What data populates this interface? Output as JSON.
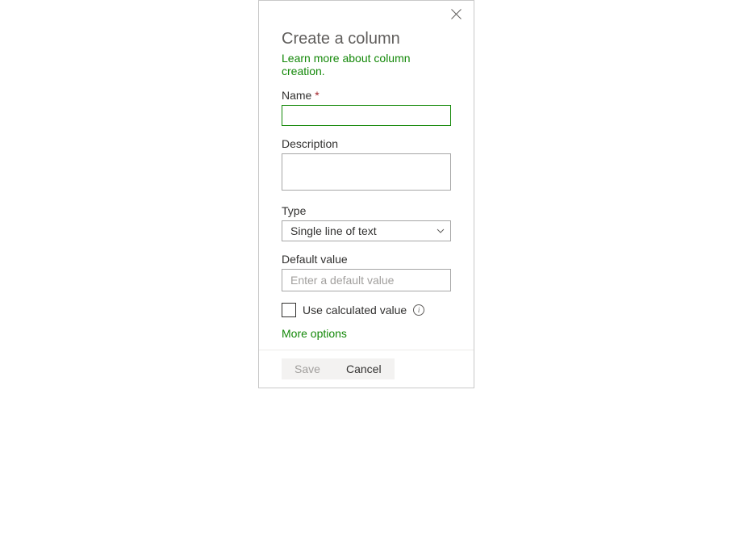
{
  "header": {
    "title": "Create a column",
    "learn_more": "Learn more about column creation."
  },
  "fields": {
    "name": {
      "label": "Name",
      "required": "*",
      "value": ""
    },
    "description": {
      "label": "Description",
      "value": ""
    },
    "type": {
      "label": "Type",
      "selected": "Single line of text"
    },
    "default_value": {
      "label": "Default value",
      "placeholder": "Enter a default value",
      "value": ""
    },
    "calculated": {
      "label": "Use calculated value"
    }
  },
  "more_options": "More options",
  "buttons": {
    "save": "Save",
    "cancel": "Cancel"
  }
}
